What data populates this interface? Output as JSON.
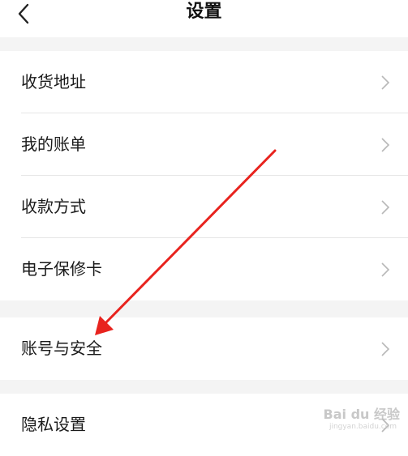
{
  "header": {
    "title": "设置"
  },
  "groups": [
    {
      "items": [
        {
          "label": "收货地址"
        },
        {
          "label": "我的账单"
        },
        {
          "label": "收款方式"
        },
        {
          "label": "电子保修卡"
        }
      ]
    },
    {
      "items": [
        {
          "label": "账号与安全"
        }
      ]
    },
    {
      "items": [
        {
          "label": "隐私设置"
        }
      ]
    }
  ],
  "annotation": {
    "color": "#e8231e"
  },
  "watermark": {
    "text": "Bai du 经验",
    "sub": "jingyan.baidu.com"
  },
  "colors": {
    "background": "#f4f4f4",
    "card": "#ffffff",
    "divider": "#e6e6e6",
    "chevron": "#b8b8b8"
  }
}
